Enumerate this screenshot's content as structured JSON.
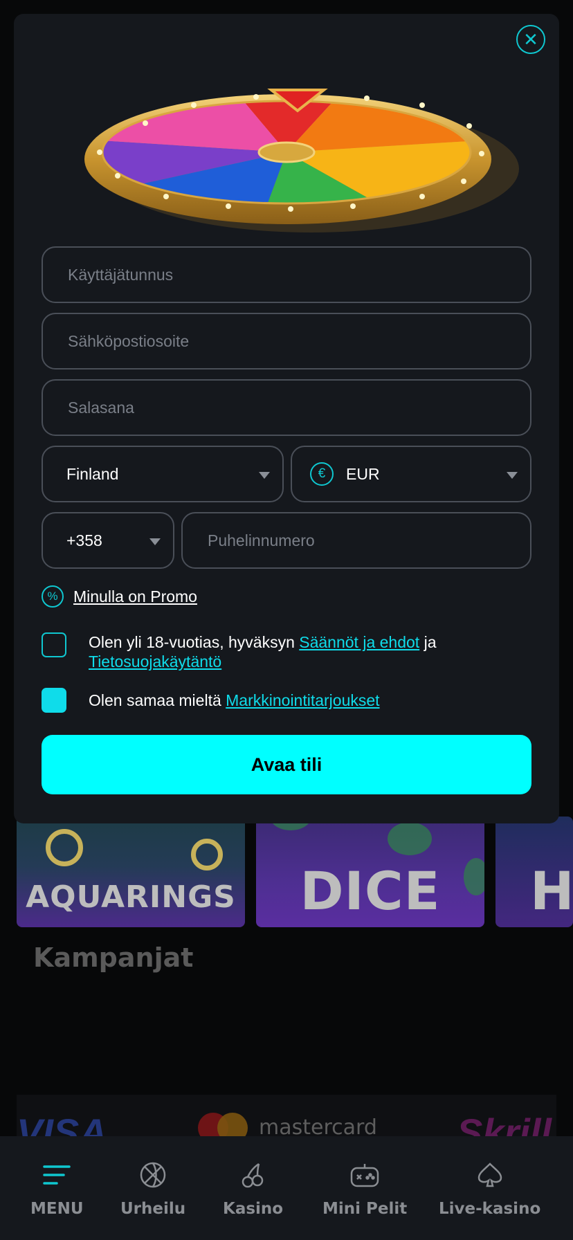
{
  "modal": {
    "fields": {
      "username_placeholder": "Käyttäjätunnus",
      "email_placeholder": "Sähköpostiosoite",
      "password_placeholder": "Salasana",
      "country": "Finland",
      "currency": "EUR",
      "currency_symbol": "€",
      "phone_code": "+358",
      "phone_placeholder": "Puhelinnumero"
    },
    "promo_label": "Minulla on Promo",
    "age_terms": {
      "text_before": "Olen yli 18-vuotias, hyväksyn",
      "terms_link": "Säännöt ja ehdot",
      "text_middle": "ja",
      "privacy_link": "Tietosuojakäytäntö",
      "checked": false
    },
    "marketing": {
      "text_before": "Olen samaa mieltä",
      "link": "Markkinointitarjoukset",
      "checked": true
    },
    "submit_label": "Avaa tili"
  },
  "background": {
    "games": [
      "AQUARINGS",
      "DICE",
      "H"
    ],
    "section_title": "Kampanjat",
    "payments": [
      "VISA",
      "mastercard",
      "Skrill"
    ]
  },
  "bottom_nav": [
    {
      "label": "MENU",
      "icon": "menu-lines-icon",
      "active": true
    },
    {
      "label": "Urheilu",
      "icon": "basketball-icon",
      "active": false
    },
    {
      "label": "Kasino",
      "icon": "cherry-icon",
      "active": false
    },
    {
      "label": "Mini Pelit",
      "icon": "gamepad-icon",
      "active": false
    },
    {
      "label": "Live-kasino",
      "icon": "spade-icon",
      "active": false
    }
  ],
  "colors": {
    "accent": "#00ffff",
    "link": "#0fdcea",
    "modal_bg": "#15181d"
  }
}
